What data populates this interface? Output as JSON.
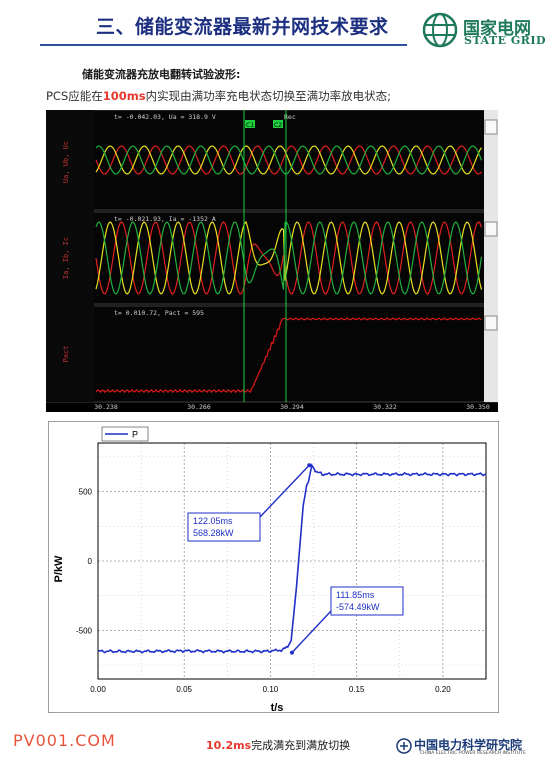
{
  "header": {
    "title": "三、储能变流器最新并网技术要求",
    "logo_cn": "国家电网",
    "logo_en": "STATE GRID"
  },
  "subtitle": "储能变流器充放电翻转试验波形:",
  "description": {
    "prefix": "PCS应能在",
    "highlight": "100ms",
    "suffix": "内实现由满功率充电状态切换至满功率放电状态;"
  },
  "scope": {
    "panel1_readout": "t= -0.042.03, Ua = 318.9 V",
    "panel2_readout": "t= -0.021.93, Ia = -1352 A",
    "panel3_readout": "t= 0.010.72, Pact = 595",
    "rec_label": "Rec",
    "cursor1_label": "C1",
    "cursor2_label": "C2",
    "panel1_axis": "Ua, Ub, Uc",
    "panel2_axis": "Ia, Ib, Ic",
    "panel3_axis": "Pact",
    "x_ticks": [
      "30.238",
      "30.266",
      "30.294",
      "30.322",
      "30.350"
    ],
    "colors": {
      "phase_a": "#e02020",
      "phase_b": "#e8e020",
      "phase_c": "#20b040",
      "power": "#d01818",
      "background": "#000000",
      "cursor": "#20d040"
    }
  },
  "chart_data": {
    "type": "line",
    "title": "",
    "xlabel": "t/s",
    "ylabel": "P/kW",
    "xlim": [
      0,
      0.225
    ],
    "ylim": [
      -850,
      850
    ],
    "x_ticks": [
      "0.00",
      "0.05",
      "0.10",
      "0.15",
      "0.20"
    ],
    "y_ticks": [
      "500",
      "0",
      "-500"
    ],
    "grid": true,
    "legend": "top-left",
    "series": [
      {
        "name": "P",
        "color": "#1f2fc8",
        "x": [
          0.0,
          0.02,
          0.05,
          0.08,
          0.1,
          0.107,
          0.11,
          0.112,
          0.115,
          0.117,
          0.119,
          0.121,
          0.122,
          0.124,
          0.126,
          0.13,
          0.15,
          0.2,
          0.225
        ],
        "y": [
          -650,
          -652,
          -648,
          -651,
          -650,
          -640,
          -620,
          -574,
          -200,
          100,
          400,
          540,
          568,
          690,
          650,
          625,
          625,
          625,
          625
        ]
      }
    ],
    "annotations": [
      {
        "time": "122.05ms",
        "value": "568.28kW"
      },
      {
        "time": "111.85ms",
        "value": "-574.49kW"
      }
    ]
  },
  "footer": {
    "left": "PV001.COM",
    "center_highlight": "10.2ms",
    "center_text": "完成满充到满放切换",
    "right_cn": "中国电力科学研究院",
    "right_en": "CHINA ELECTRIC POWER RESEARCH INSTITUTE"
  }
}
